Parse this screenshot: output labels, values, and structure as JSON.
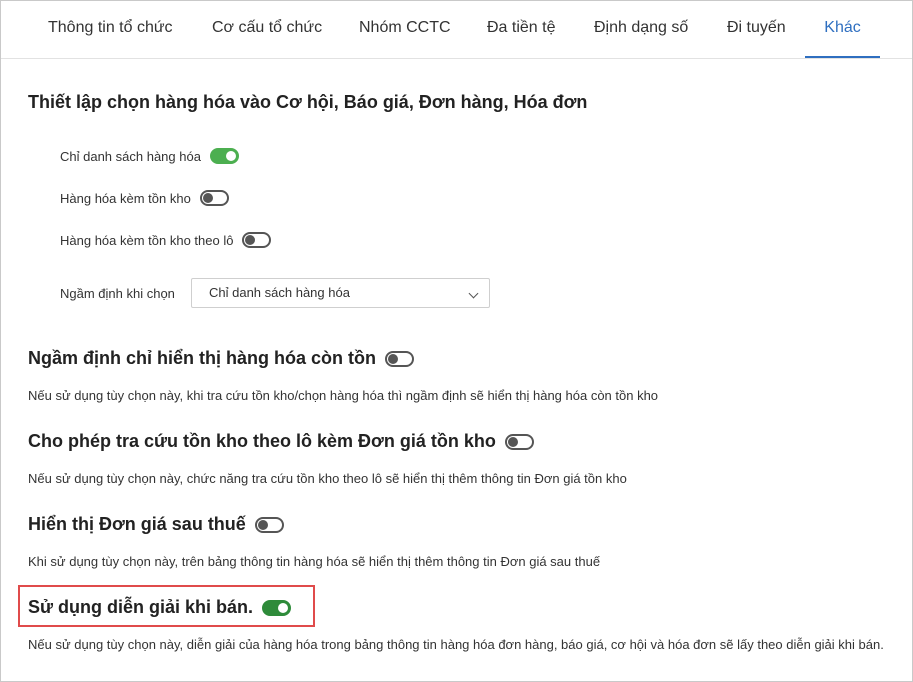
{
  "tabs": [
    "Thông tin tổ chức",
    "Cơ cấu tổ chức",
    "Nhóm CCTC",
    "Đa tiền tệ",
    "Định dạng số",
    "Đi tuyến",
    "Khác"
  ],
  "active_tab": "Khác",
  "product_selection": {
    "title": "Thiết lập chọn hàng hóa vào Cơ hội, Báo giá, Đơn hàng, Hóa đơn",
    "options": [
      {
        "label": "Chỉ danh sách hàng hóa",
        "enabled": true
      },
      {
        "label": "Hàng hóa kèm tồn kho",
        "enabled": false
      },
      {
        "label": "Hàng hóa kèm tồn kho theo lô",
        "enabled": false
      }
    ],
    "default_label": "Ngầm định khi chọn",
    "default_value": "Chỉ danh sách hàng hóa"
  },
  "settings": [
    {
      "title": "Ngầm định chỉ hiển thị hàng hóa còn tồn",
      "enabled": false,
      "description": "Nếu sử dụng tùy chọn này, khi tra cứu tồn kho/chọn hàng hóa thì ngầm định sẽ hiển thị hàng hóa còn tồn kho"
    },
    {
      "title": "Cho phép tra cứu tồn kho theo lô kèm Đơn giá tồn kho",
      "enabled": false,
      "description": "Nếu sử dụng tùy chọn này, chức năng tra cứu tồn kho theo lô sẽ hiển thị thêm thông tin Đơn giá tồn kho"
    },
    {
      "title": "Hiển thị Đơn giá sau thuế",
      "enabled": false,
      "description": "Khi sử dụng tùy chọn này, trên bảng thông tin hàng hóa sẽ hiển thị thêm thông tin Đơn giá sau thuế"
    },
    {
      "title": "Sử dụng diễn giải khi bán.",
      "enabled": true,
      "description": "Nếu sử dụng tùy chọn này, diễn giải của hàng hóa trong bảng thông tin hàng hóa đơn hàng, báo giá, cơ hội và hóa đơn sẽ lấy theo diễn giải khi bán."
    }
  ],
  "colors": {
    "accent": "#2f6fc0",
    "toggle_on": "#4caf50",
    "highlight": "#e04b4b"
  }
}
